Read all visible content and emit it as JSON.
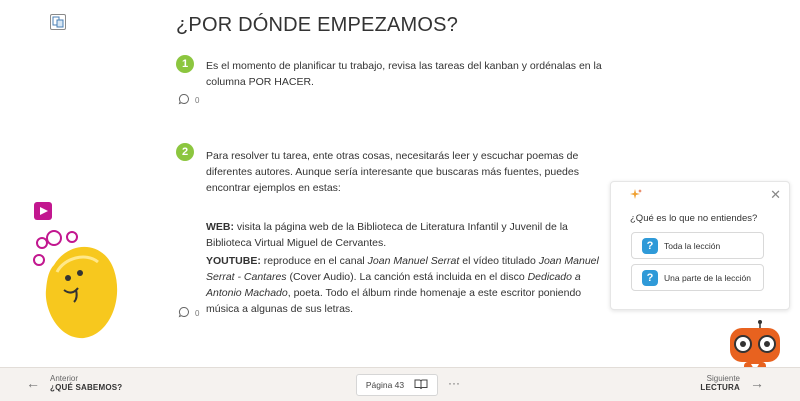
{
  "page": {
    "title": "¿POR DÓNDE EMPEZAMOS?"
  },
  "sections": [
    {
      "number": "1",
      "text": "Es el momento de planificar tu trabajo, revisa las tareas del kanban y ordénalas en la columna POR HACER.",
      "comments": "0"
    },
    {
      "number": "2",
      "intro": "Para resolver tu tarea, ente otras cosas, necesitarás leer y escuchar poemas de diferentes autores. Aunque sería interesante que buscaras más fuentes, puedes encontrar ejemplos en estas:",
      "web_label": "WEB:",
      "web_text": " visita la página web de la Biblioteca de Literatura Infantil y Juvenil de la Biblioteca Virtual Miguel de Cervantes.",
      "yt_label": "YOUTUBE:",
      "yt_text_1": " reproduce en el canal ",
      "yt_channel": "Joan Manuel Serrat",
      "yt_text_2": " el vídeo titulado ",
      "yt_video": "Joan Manuel Serrat - Cantares",
      "yt_text_3": " (Cover Audio). La canción está incluida en el disco ",
      "yt_album": "Dedicado a Antonio Machado",
      "yt_text_4": ", poeta. Todo el álbum rinde homenaje a este escritor poniendo música a algunas de sus letras.",
      "comments": "0"
    }
  ],
  "popup": {
    "question": "¿Qué es lo que no entiendes?",
    "option_whole": "Toda la lección",
    "option_part": "Una parte de la lección",
    "close_glyph": "✕"
  },
  "footer": {
    "prev_small": "Anterior",
    "prev_big": "¿QUÉ SABEMOS?",
    "page_label": "Página 43",
    "more_glyph": "···",
    "next_small": "Siguiente",
    "next_big": "LECTURA"
  },
  "colors": {
    "step_green": "#8cc63f",
    "help_blue": "#2f9ad8",
    "mascot_yellow": "#f7c81e",
    "mascot_purple": "#c2178f",
    "robot_orange": "#e8621f"
  },
  "icons": [
    "book-logo-icon",
    "comment-icon",
    "sparkle-icon",
    "close-icon",
    "question-icon",
    "play-icon",
    "arrow-left-icon",
    "arrow-right-icon",
    "open-book-icon"
  ]
}
